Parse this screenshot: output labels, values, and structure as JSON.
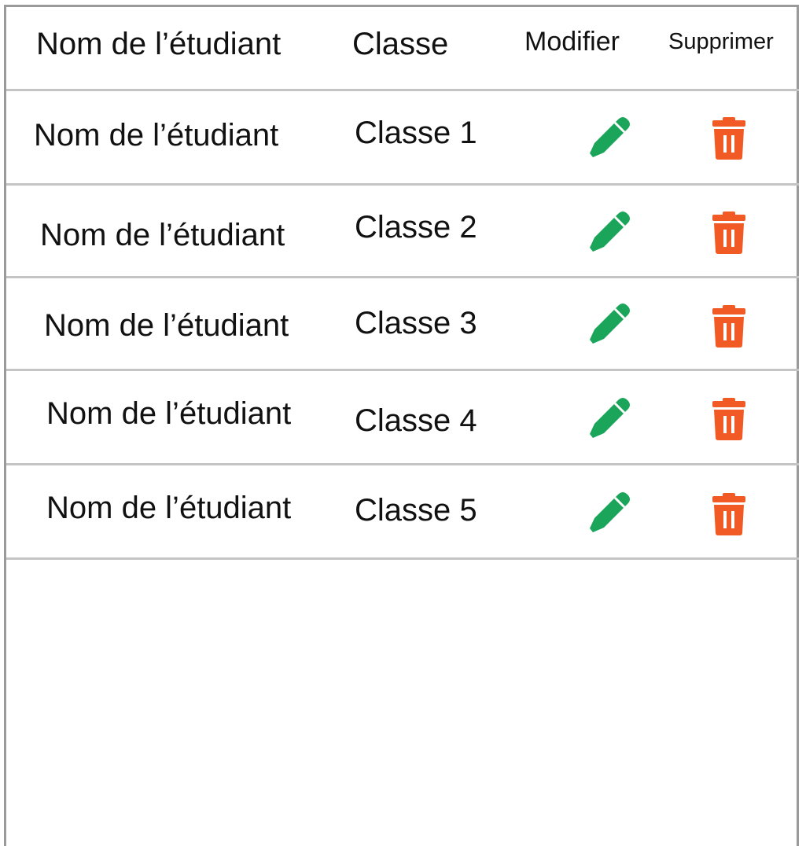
{
  "table": {
    "headers": {
      "name": "Nom de l’étudiant",
      "class": "Classe",
      "edit": "Modifier",
      "delete": "Supprimer"
    },
    "rows": [
      {
        "name": "Nom de l’étudiant",
        "class": "Classe 1"
      },
      {
        "name": "Nom de l’étudiant",
        "class": "Classe 2"
      },
      {
        "name": "Nom de l’étudiant",
        "class": "Classe 3"
      },
      {
        "name": "Nom de l’étudiant",
        "class": "Classe 4"
      },
      {
        "name": "Nom de l’étudiant",
        "class": "Classe 5"
      }
    ]
  },
  "icons": {
    "edit": "pencil-icon",
    "delete": "trash-icon"
  },
  "colors": {
    "edit": "#1aa55a",
    "delete": "#f15a24",
    "divider": "#c4c4c4",
    "border": "#9a9a9a"
  }
}
